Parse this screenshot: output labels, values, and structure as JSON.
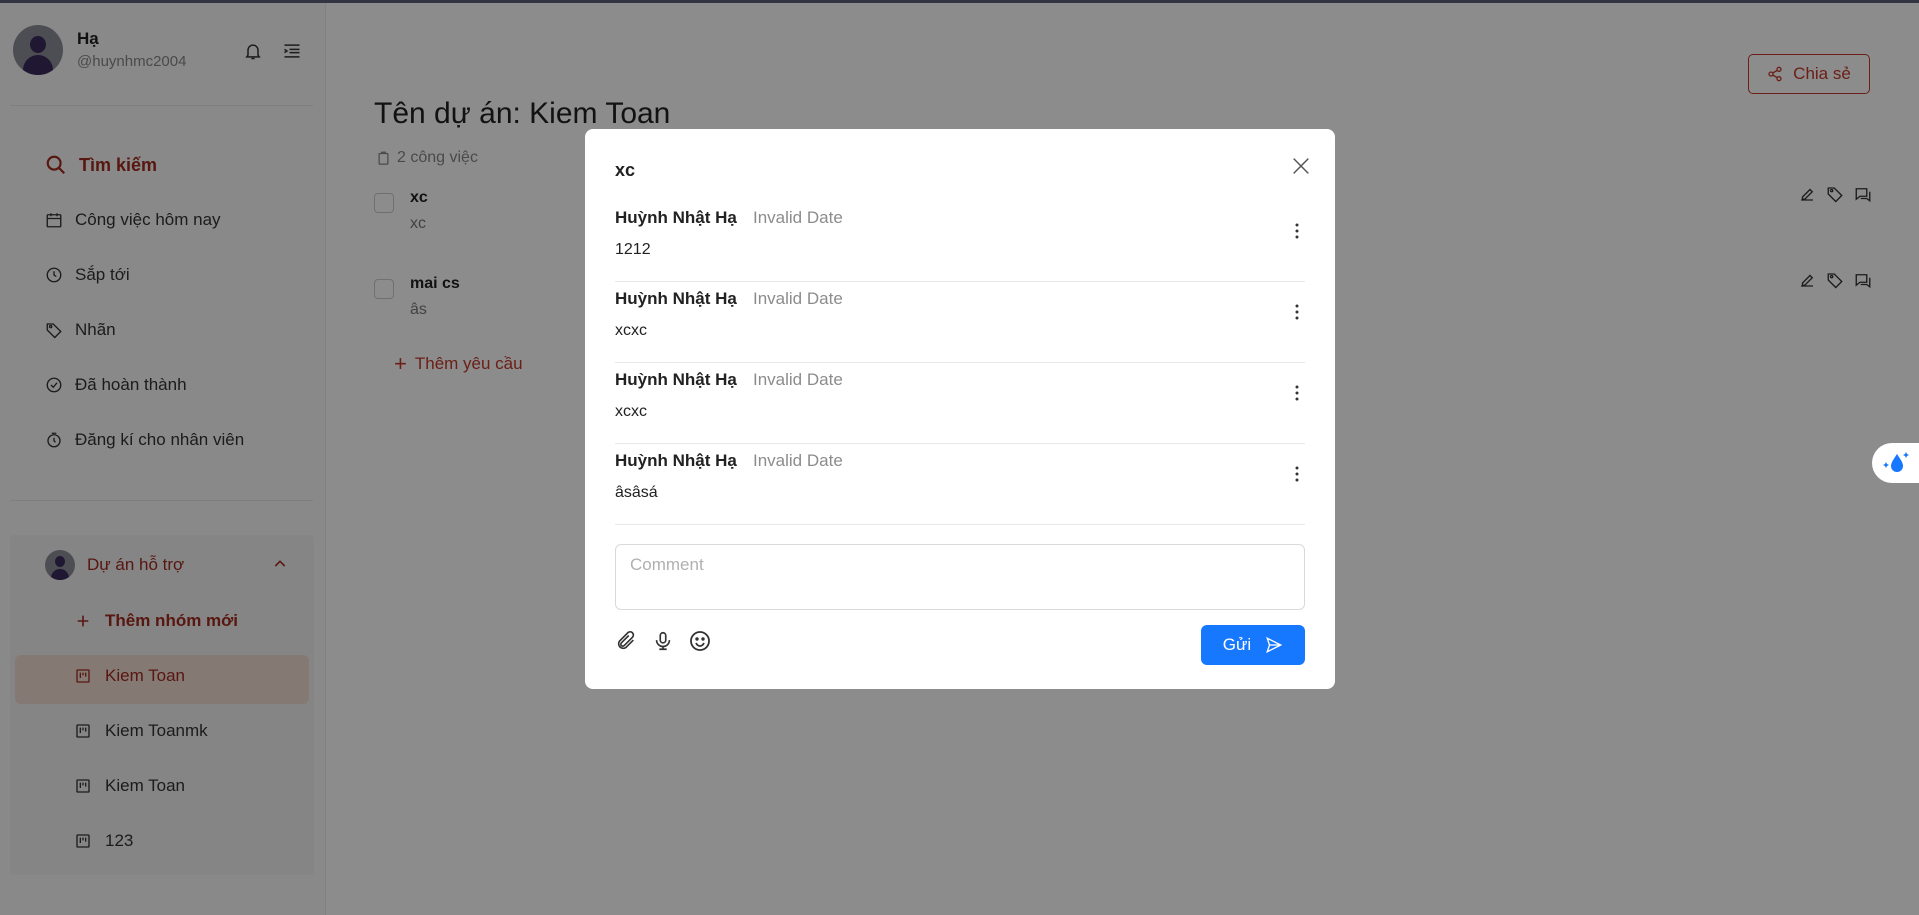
{
  "user": {
    "name": "Hạ",
    "handle": "@huynhmc2004"
  },
  "nav": {
    "search": "Tìm kiếm",
    "items": [
      {
        "label": "Công việc hôm nay",
        "icon": "calendar-icon"
      },
      {
        "label": "Sắp tới",
        "icon": "clock-icon"
      },
      {
        "label": "Nhãn",
        "icon": "tag-icon"
      },
      {
        "label": "Đã hoàn thành",
        "icon": "check-circle-icon"
      },
      {
        "label": "Đăng kí cho nhân viên",
        "icon": "timer-icon"
      }
    ]
  },
  "projects": {
    "header": "Dự án hỗ trợ",
    "add_group": "Thêm nhóm mới",
    "items": [
      "Kiem Toan",
      "Kiem Toanmk",
      "Kiem Toan",
      "123"
    ],
    "active_index": 0
  },
  "main": {
    "title": "Tên dự án: Kiem Toan",
    "task_count": "2 công việc",
    "share": "Chia sẻ",
    "add_request": "Thêm yêu cầu",
    "tasks": [
      {
        "title": "xc",
        "desc": "xc"
      },
      {
        "title": "mai cs",
        "desc": "âs"
      }
    ]
  },
  "modal": {
    "title": "xc",
    "comments": [
      {
        "author": "Huỳnh Nhật Hạ",
        "date": "Invalid Date",
        "text": "1212"
      },
      {
        "author": "Huỳnh Nhật Hạ",
        "date": "Invalid Date",
        "text": "xcxc"
      },
      {
        "author": "Huỳnh Nhật Hạ",
        "date": "Invalid Date",
        "text": "xcxc"
      },
      {
        "author": "Huỳnh Nhật Hạ",
        "date": "Invalid Date",
        "text": "âsâsá"
      }
    ],
    "comment_placeholder": "Comment",
    "send_label": "Gửi"
  },
  "colors": {
    "accent": "#a12a1e",
    "primary": "#1677ff",
    "overlay": "rgba(0,0,0,0.45)"
  }
}
